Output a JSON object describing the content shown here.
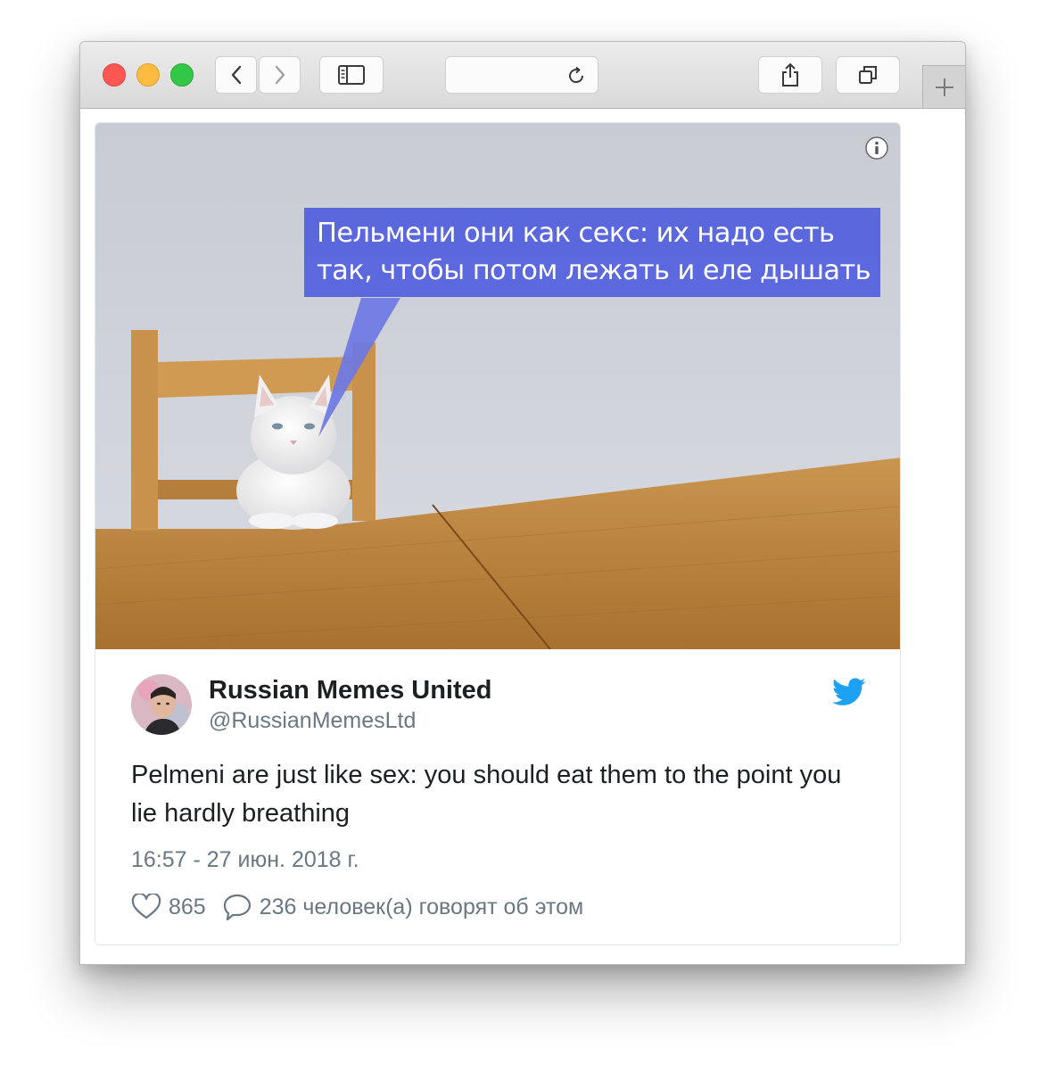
{
  "browser": {
    "icons": {
      "back": "chevron-left-icon",
      "forward": "chevron-right-icon",
      "sidebar": "sidebar-icon",
      "reload": "reload-icon",
      "share": "share-icon",
      "tabs": "tabs-icon",
      "new_tab": "plus-icon"
    },
    "address_text": ""
  },
  "tweet": {
    "image_caption": {
      "line1": "Пельмени они как секс: их надо есть",
      "line2": "так, чтобы потом лежать и еле дышать"
    },
    "author_name": "Russian Memes United",
    "author_handle": "@RussianMemesLtd",
    "text": "Pelmeni are just like sex: you should eat them to the point you lie hardly breathing",
    "timestamp": "16:57 - 27 июн. 2018 г.",
    "likes": "865",
    "replies": "236 человек(а) говорят об этом"
  },
  "colors": {
    "caption_bg": "#5260de",
    "twitter_blue": "#1da1f2",
    "traffic_red": "#fc5753",
    "traffic_yellow": "#fdbc40",
    "traffic_green": "#33c748"
  }
}
